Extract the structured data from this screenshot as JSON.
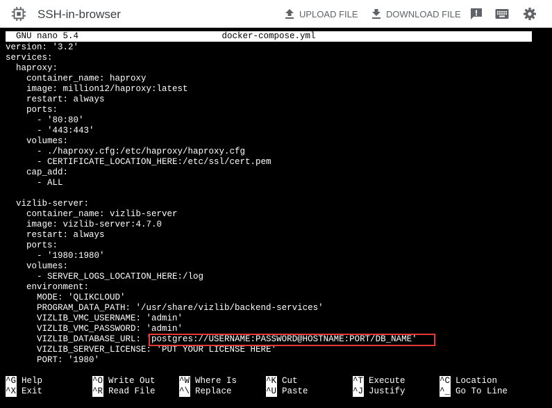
{
  "header": {
    "title": "SSH-in-browser",
    "upload_label": "UPLOAD FILE",
    "download_label": "DOWNLOAD FILE"
  },
  "nano": {
    "version": "GNU nano 5.4",
    "filename": "docker-compose.yml"
  },
  "lines": [
    "version: '3.2'",
    "services:",
    "  haproxy:",
    "    container_name: haproxy",
    "    image: million12/haproxy:latest",
    "    restart: always",
    "    ports:",
    "      - '80:80'",
    "      - '443:443'",
    "    volumes:",
    "      - ./haproxy.cfg:/etc/haproxy/haproxy.cfg",
    "      - CERTIFICATE_LOCATION_HERE:/etc/ssl/cert.pem",
    "    cap_add:",
    "      - ALL",
    "",
    "  vizlib-server:",
    "    container_name: vizlib-server",
    "    image: vizlib-server:4.7.0",
    "    restart: always",
    "    ports:",
    "      - '1980:1980'",
    "    volumes:",
    "      - SERVER_LOGS_LOCATION_HERE:/log",
    "    environment:",
    "      MODE: 'QLIKCLOUD'",
    "      PROGRAM_DATA_PATH: '/usr/share/vizlib/backend-services'",
    "      VIZLIB_VMC_USERNAME: 'admin'",
    "      VIZLIB_VMC_PASSWORD: 'admin'",
    "      VIZLIB_DATABASE_URL: 'postgres://USERNAME:PASSWORD@HOSTNAME:PORT/DB_NAME'",
    "      VIZLIB_SERVER_LICENSE: 'PUT YOUR LICENSE HERE'",
    "      PORT: '1980'"
  ],
  "shortcuts": [
    {
      "key": "^G",
      "label": "Help"
    },
    {
      "key": "^O",
      "label": "Write Out"
    },
    {
      "key": "^W",
      "label": "Where Is"
    },
    {
      "key": "^K",
      "label": "Cut"
    },
    {
      "key": "^T",
      "label": "Execute"
    },
    {
      "key": "^C",
      "label": "Location"
    },
    {
      "key": "^X",
      "label": "Exit"
    },
    {
      "key": "^R",
      "label": "Read File"
    },
    {
      "key": "^\\",
      "label": "Replace"
    },
    {
      "key": "^U",
      "label": "Paste"
    },
    {
      "key": "^J",
      "label": "Justify"
    },
    {
      "key": "^_",
      "label": "Go To Line"
    }
  ],
  "colors": {
    "highlight_border": "#e53935",
    "terminal_bg": "#000000",
    "header_icon": "#5f6368"
  },
  "icons": [
    "chip-icon",
    "upload-icon",
    "download-icon",
    "feedback-icon",
    "keyboard-icon",
    "settings-gear-icon"
  ]
}
